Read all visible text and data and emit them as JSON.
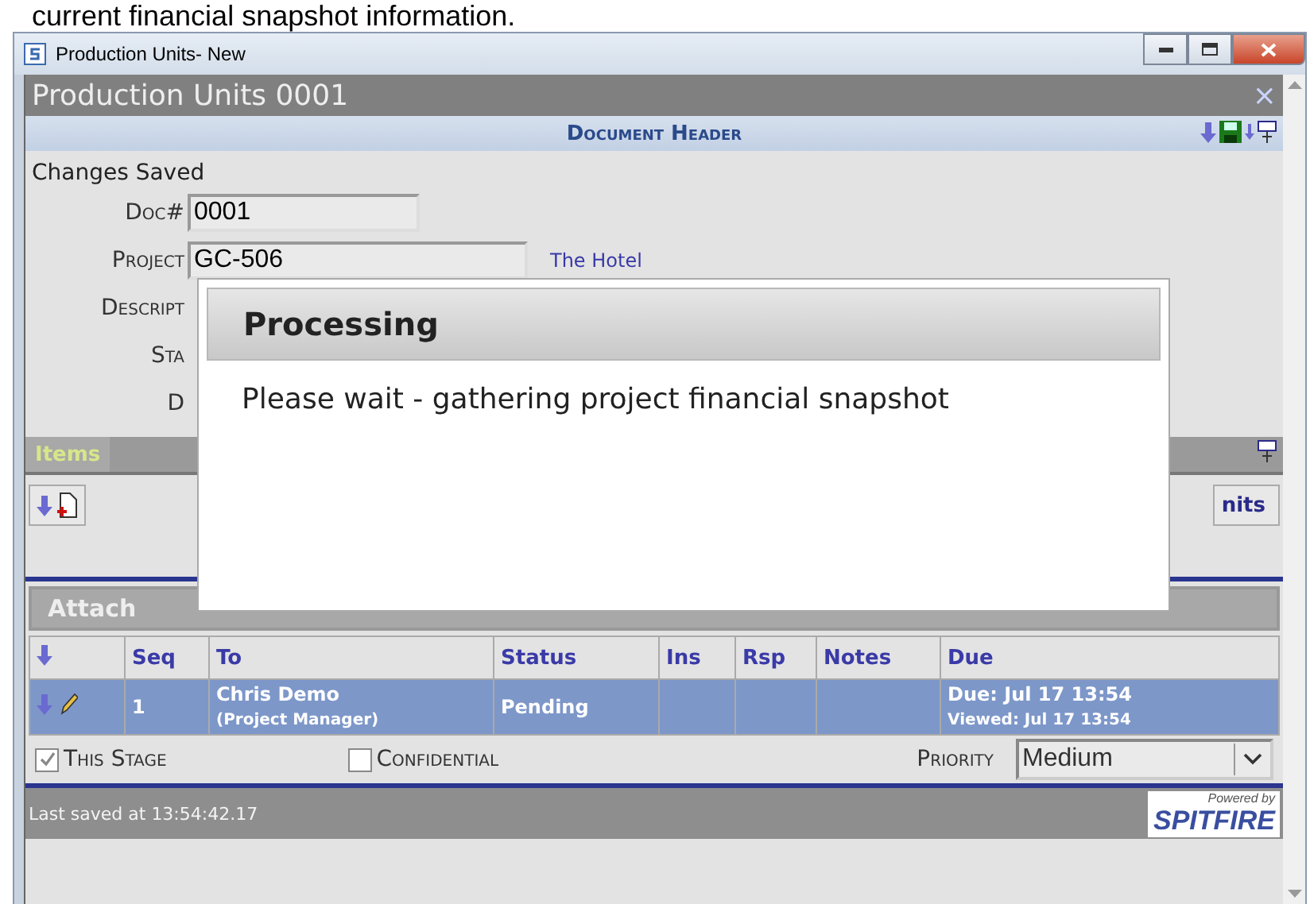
{
  "caption": "current financial snapshot information.",
  "window": {
    "title": "Production Units- New"
  },
  "app": {
    "title": "Production Units 0001",
    "close": "×"
  },
  "doc_header": {
    "title": "Document Header"
  },
  "status_message": "Changes Saved",
  "form": [
    {
      "label": "Doc#",
      "value": "0001",
      "kind": "short"
    },
    {
      "label": "Project",
      "value": "GC-506",
      "kind": "long",
      "link": "The Hotel"
    },
    {
      "label": "Descript",
      "kind": "label"
    },
    {
      "label": "Sta",
      "kind": "label"
    },
    {
      "label": "D",
      "kind": "label"
    }
  ],
  "items_tabs": [
    {
      "label": "Items",
      "selected": true
    }
  ],
  "toolbar_button": "nits",
  "attach_heading": "Attach",
  "table": {
    "columns": [
      "Seq",
      "To",
      "Status",
      "Ins",
      "Rsp",
      "Notes",
      "Due"
    ],
    "rows": [
      {
        "selected": true,
        "seq": "1",
        "to": "Chris Demo",
        "role": "(Project Manager)",
        "status": "Pending",
        "due": "Due: Jul 17 13:54",
        "viewed": "Viewed: Jul 17 13:54"
      }
    ]
  },
  "options": [
    {
      "label": "This Stage",
      "checked": true
    },
    {
      "label": "Confidential",
      "checked": false
    }
  ],
  "priority": {
    "label": "Priority",
    "value": "Medium"
  },
  "footer": {
    "saved": "Last saved at 13:54:42.17",
    "logo_small": "Powered by",
    "logo": "SPITFIRE"
  },
  "dialog": {
    "title": "Processing",
    "message": "Please wait - gathering project financial snapshot"
  }
}
